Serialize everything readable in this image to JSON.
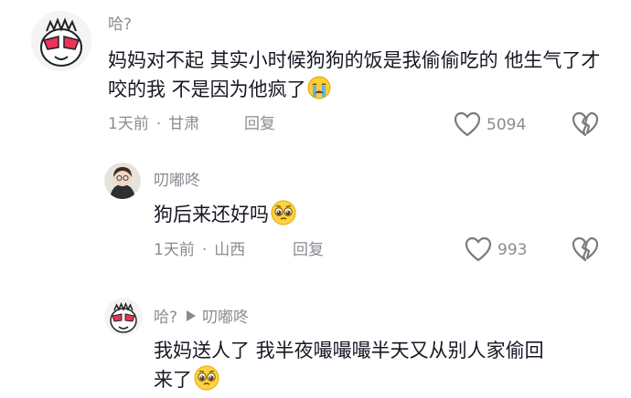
{
  "comments": [
    {
      "username": "哈?",
      "text": "妈妈对不起 其实小时候狗狗的饭是我偷偷吃的 他生气了才咬的我 不是因为他疯了",
      "emoji": "crying-face-emoji",
      "time": "1天前",
      "location": "甘肃",
      "reply_label": "回复",
      "likes": "5094",
      "icons": [
        "avatar",
        "heart-icon",
        "broken-heart-icon"
      ]
    },
    {
      "username": "叨嘟咚",
      "text": "狗后来还好吗",
      "emoji": "pleading-face-emoji",
      "time": "1天前",
      "location": "山西",
      "reply_label": "回复",
      "likes": "993",
      "icons": [
        "avatar",
        "heart-icon",
        "broken-heart-icon"
      ]
    },
    {
      "username": "哈?",
      "reply_to": "叨嘟咚",
      "text_line1": "我妈送人了 我半夜嘬嘬嘬半天又从别人家偷回",
      "text_line2": "来了",
      "emoji": "pleading-face-emoji",
      "icons": [
        "avatar",
        "reply-arrow-icon"
      ]
    }
  ]
}
